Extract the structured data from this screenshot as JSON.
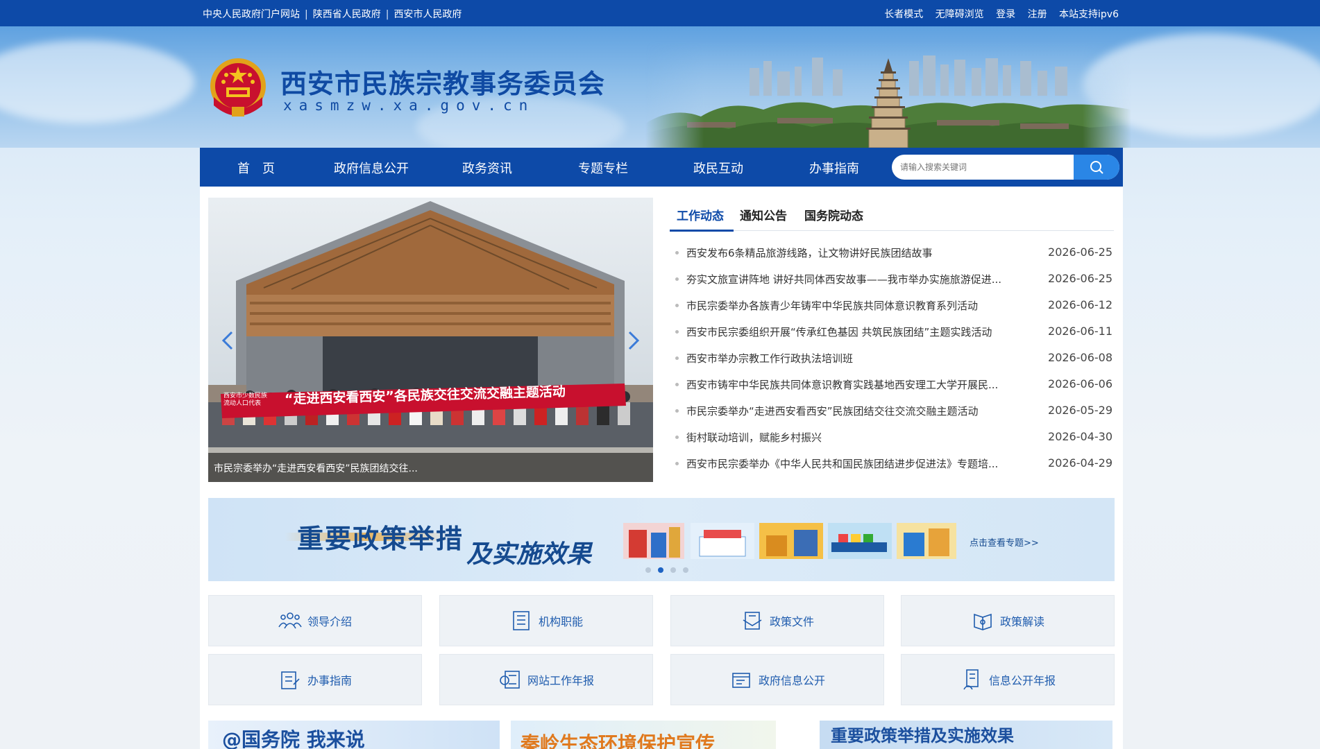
{
  "topbar": {
    "left_links": [
      "中央人民政府门户网站",
      "陕西省人民政府",
      "西安市人民政府"
    ],
    "right_links": [
      "长者模式",
      "无障碍浏览",
      "登录",
      "注册",
      "本站支持ipv6"
    ]
  },
  "header": {
    "title": "西安市民族宗教事务委员会",
    "domain": "xasmzw.xa.gov.cn"
  },
  "nav": {
    "items": [
      "首　页",
      "政府信息公开",
      "政务资讯",
      "专题专栏",
      "政民互动",
      "办事指南"
    ],
    "search_placeholder": "请输入搜索关键词"
  },
  "slider": {
    "caption": "市民宗委举办“走进西安看西安”民族团结交往...",
    "banner_text": "“走进西安看西安”各民族交往交流交融主题活动",
    "banner_small": "西安市少数民族流动人口代表"
  },
  "news": {
    "tabs": [
      "工作动态",
      "通知公告",
      "国务院动态"
    ],
    "items": [
      {
        "title": "西安发布6条精品旅游线路，让文物讲好民族团结故事",
        "date": "2026-06-25"
      },
      {
        "title": "夯实文旅宣讲阵地 讲好共同体西安故事——我市举办实施旅游促进...",
        "date": "2026-06-25"
      },
      {
        "title": "市民宗委举办各族青少年铸牢中华民族共同体意识教育系列活动",
        "date": "2026-06-12"
      },
      {
        "title": "西安市民宗委组织开展“传承红色基因 共筑民族团结”主题实践活动",
        "date": "2026-06-11"
      },
      {
        "title": "西安市举办宗教工作行政执法培训班",
        "date": "2026-06-08"
      },
      {
        "title": "西安市铸牢中华民族共同体意识教育实践基地西安理工大学开展民...",
        "date": "2026-06-06"
      },
      {
        "title": "市民宗委举办“走进西安看西安”民族团结交往交流交融主题活动",
        "date": "2026-05-29"
      },
      {
        "title": "街村联动培训，赋能乡村振兴",
        "date": "2026-04-30"
      },
      {
        "title": "西安市民宗委举办《中华人民共和国民族团结进步促进法》专题培...",
        "date": "2026-04-29"
      }
    ]
  },
  "policy_banner": {
    "title": "重要政策举措",
    "subtitle": "及实施效果",
    "link": "点击查看专题>>",
    "active_dot": 1
  },
  "quick_links": [
    {
      "label": "领导介绍",
      "icon": "people-icon"
    },
    {
      "label": "机构职能",
      "icon": "org-chart-icon"
    },
    {
      "label": "政策文件",
      "icon": "document-icon"
    },
    {
      "label": "政策解读",
      "icon": "open-book-icon"
    },
    {
      "label": "办事指南",
      "icon": "checklist-icon"
    },
    {
      "label": "网站工作年报",
      "icon": "report-icon"
    },
    {
      "label": "政府信息公开",
      "icon": "info-folder-icon"
    },
    {
      "label": "信息公开年报",
      "icon": "annual-report-icon"
    }
  ],
  "promos": {
    "left": "@国务院 我来说",
    "middle": "秦岭生态环境保护宣传",
    "right": "重要政策举措及实施效果"
  },
  "colors": {
    "primary_blue": "#0d4aa8",
    "accent_blue": "#2a86e6",
    "banner_red": "#c8102e"
  }
}
